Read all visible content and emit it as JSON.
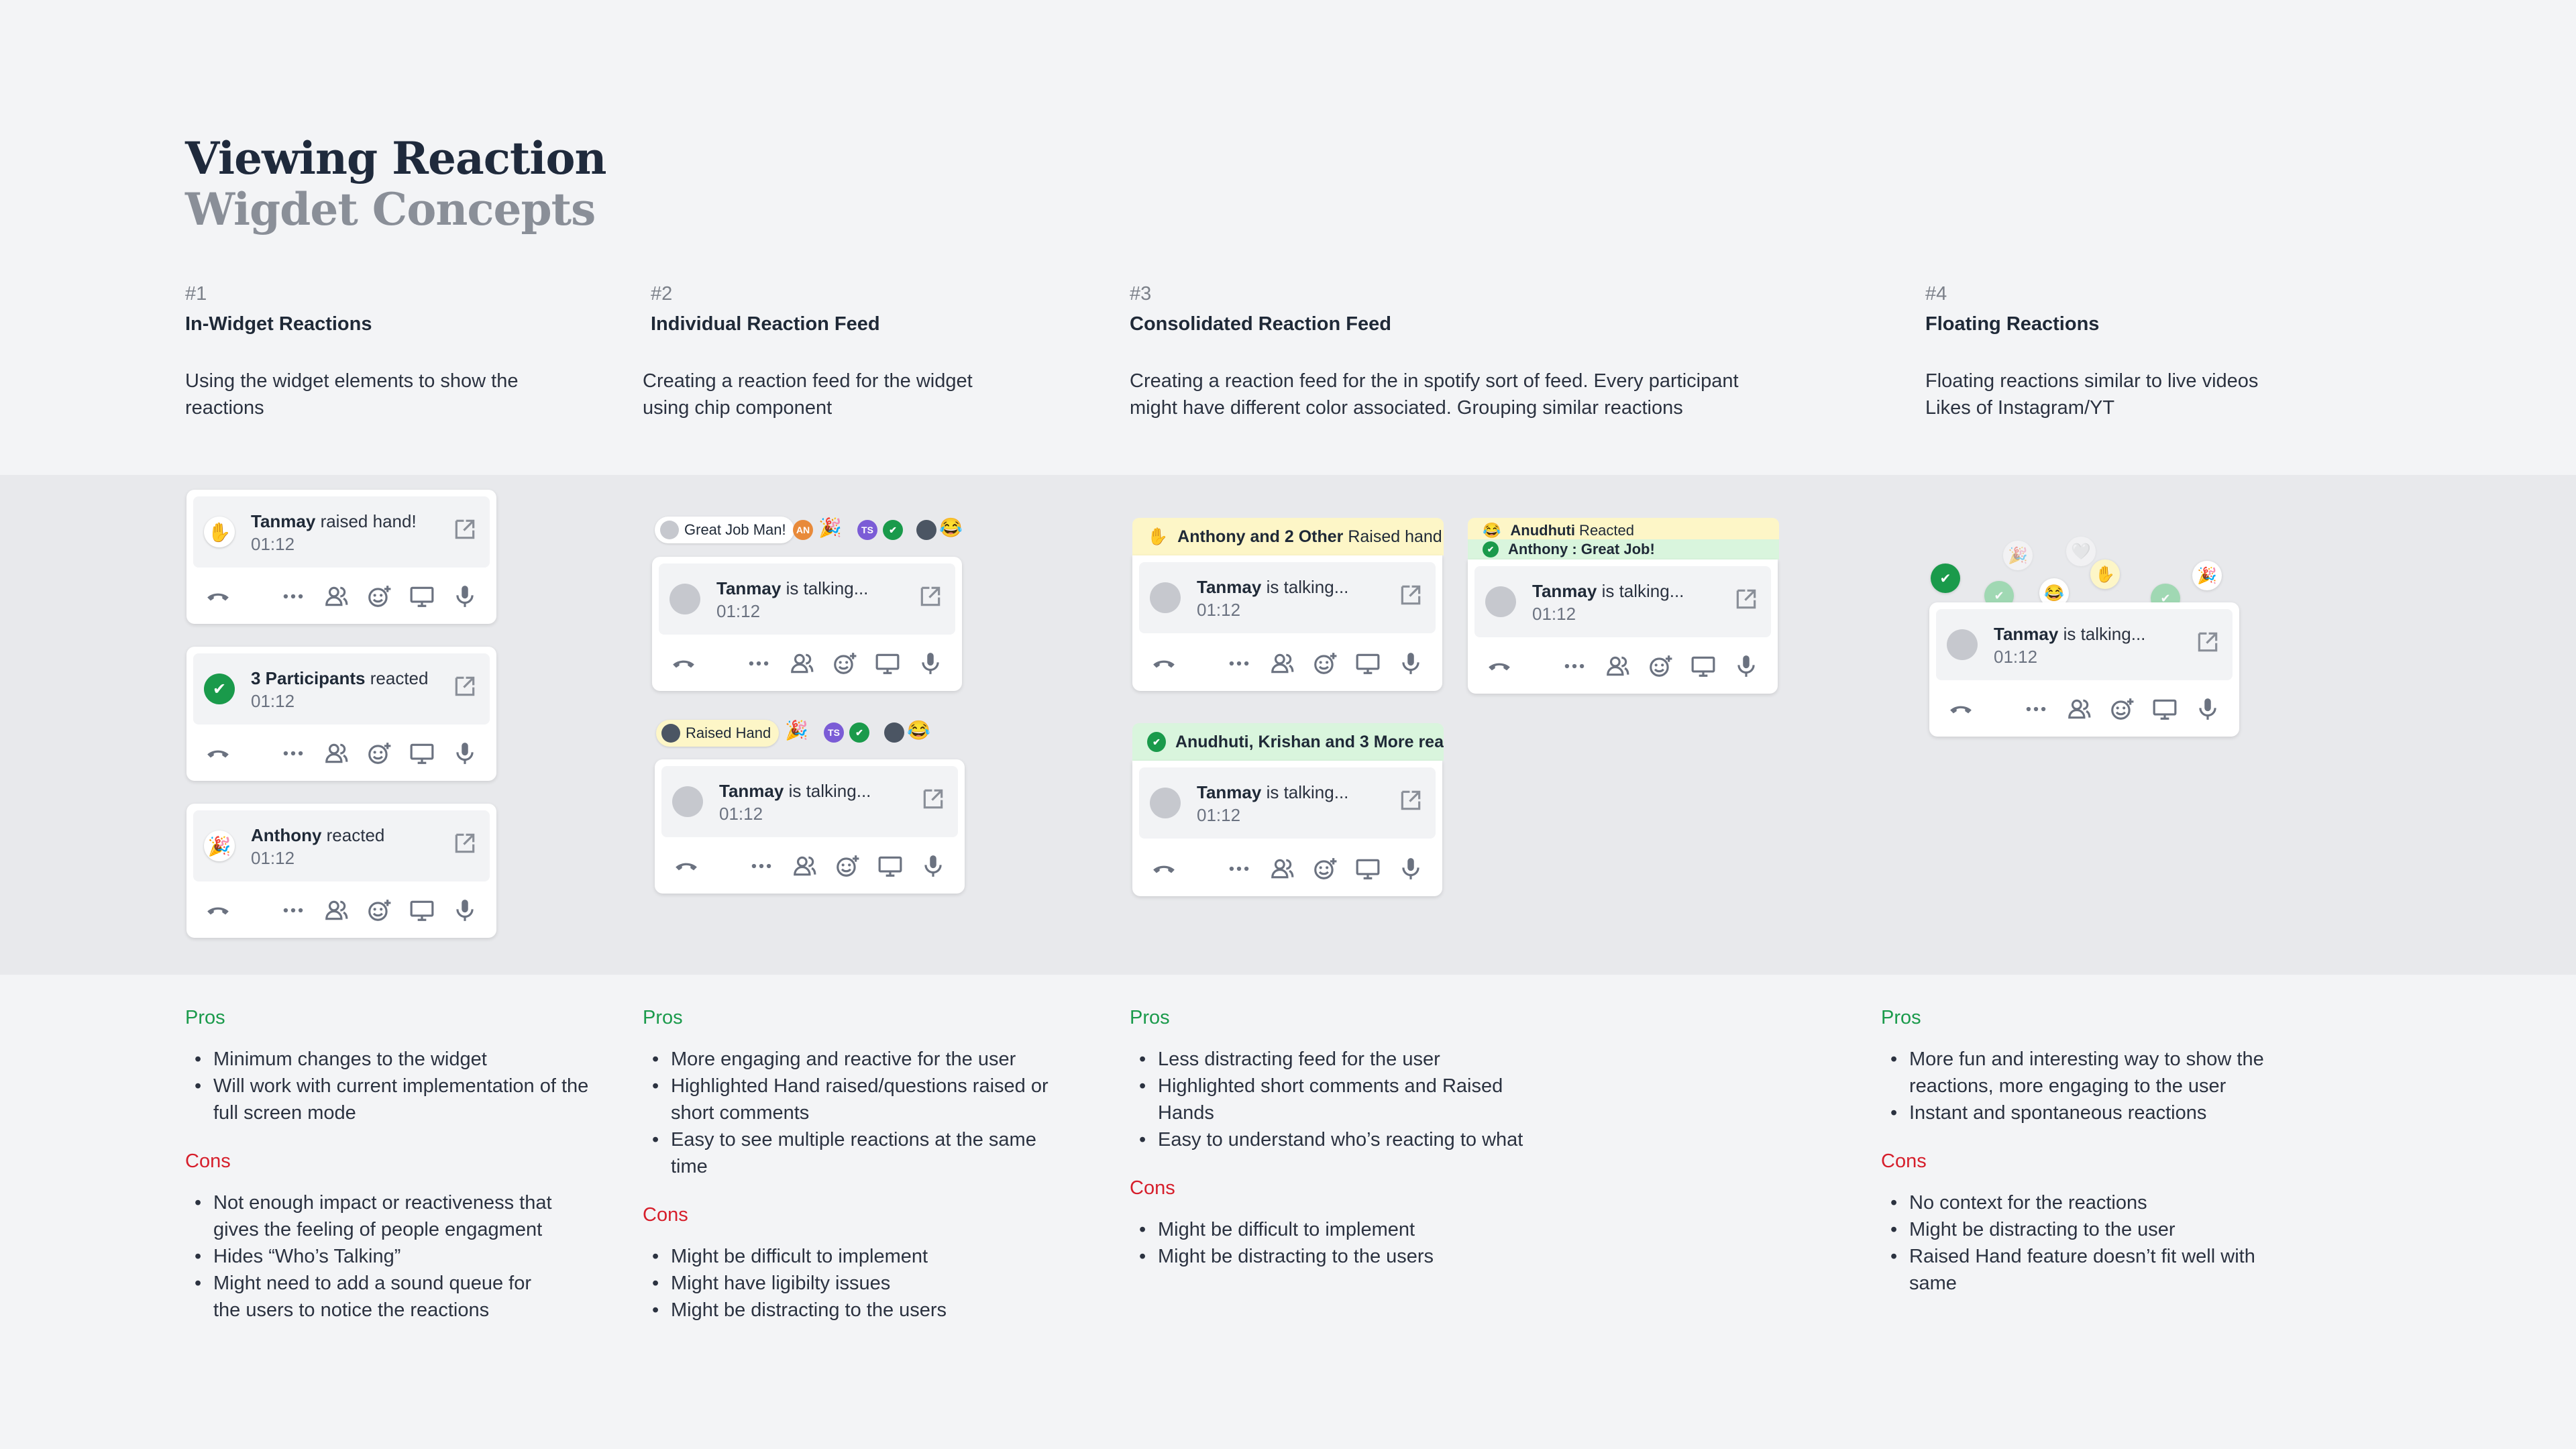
{
  "title": "Viewing Reaction",
  "subtitle": "Wigdet Concepts",
  "concepts": [
    {
      "num": "#1",
      "title": "In-Widget Reactions",
      "desc": "Using the widget elements to show the reactions"
    },
    {
      "num": "#2",
      "title": "Individual Reaction Feed",
      "desc": "Creating a reaction feed for the widget using chip component"
    },
    {
      "num": "#3",
      "title": "Consolidated Reaction Feed",
      "desc": "Creating a reaction feed for the in spotify sort of feed. Every participant might have different color associated. Grouping similar reactions"
    },
    {
      "num": "#4",
      "title": "Floating Reactions",
      "desc": "Floating reactions similar to live videos Likes of Instagram/YT"
    }
  ],
  "pros_label": "Pros",
  "cons_label": "Cons",
  "proscons": [
    {
      "pros": [
        "Minimum changes to the widget",
        "Will work with current implementation of the full screen mode"
      ],
      "cons": [
        "Not enough impact or reactiveness that gives the feeling of people engagment",
        "Hides “Who’s Talking”",
        "Might need to add a sound queue for the users to notice the reactions"
      ]
    },
    {
      "pros": [
        "More engaging and reactive for the user",
        "Highlighted Hand raised/questions raised or short comments",
        "Easy to see multiple reactions at the same time"
      ],
      "cons": [
        "Might be difficult to implement",
        "Might have ligibilty issues",
        "Might be distracting to the users"
      ]
    },
    {
      "pros": [
        "Less distracting feed for the user",
        "Highlighted short comments and Raised Hands",
        "Easy to understand who’s reacting to what"
      ],
      "cons": [
        "Might be difficult to implement",
        "Might be distracting to the users"
      ]
    },
    {
      "pros": [
        "More fun and interesting way to show the reactions, more engaging to the user",
        "Instant and spontaneous reactions"
      ],
      "cons": [
        "No context for the reactions",
        "Might be distracting to the user",
        "Raised Hand feature doesn’t fit well with same"
      ]
    }
  ],
  "widgets": {
    "w1a": {
      "name": "Tanmay",
      "status": " raised hand!",
      "time": "01:12",
      "emoji": "✋"
    },
    "w1b": {
      "name": "3 Participants",
      "status": " reacted",
      "time": "01:12",
      "emoji": "✔"
    },
    "w1c": {
      "name": "Anthony",
      "status": " reacted",
      "time": "01:12",
      "emoji": "🎉"
    },
    "talking": {
      "name": "Tanmay",
      "status": " is talking...",
      "time": "01:12"
    }
  },
  "chips": {
    "great_job": "Great Job Man!",
    "raised_hand": "Raised Hand",
    "initials_an": "AN",
    "initials_ts": "TS"
  },
  "banners": {
    "raised": {
      "bold": "Anthony and 2 Other",
      "rest": " Raised hand"
    },
    "reacted": {
      "bold": "Anudhuti, Krishan and 3 More rea",
      "rest": ""
    },
    "anudhuti": {
      "bold": "Anudhuti",
      "rest": " Reacted"
    },
    "anthony": {
      "bold": "Anthony : Great Job!",
      "rest": ""
    }
  },
  "colors": {
    "pros": "#1a9a4b",
    "cons": "#d61e2b",
    "yellow": "#fdf6c7",
    "green": "#d9f5dd"
  }
}
